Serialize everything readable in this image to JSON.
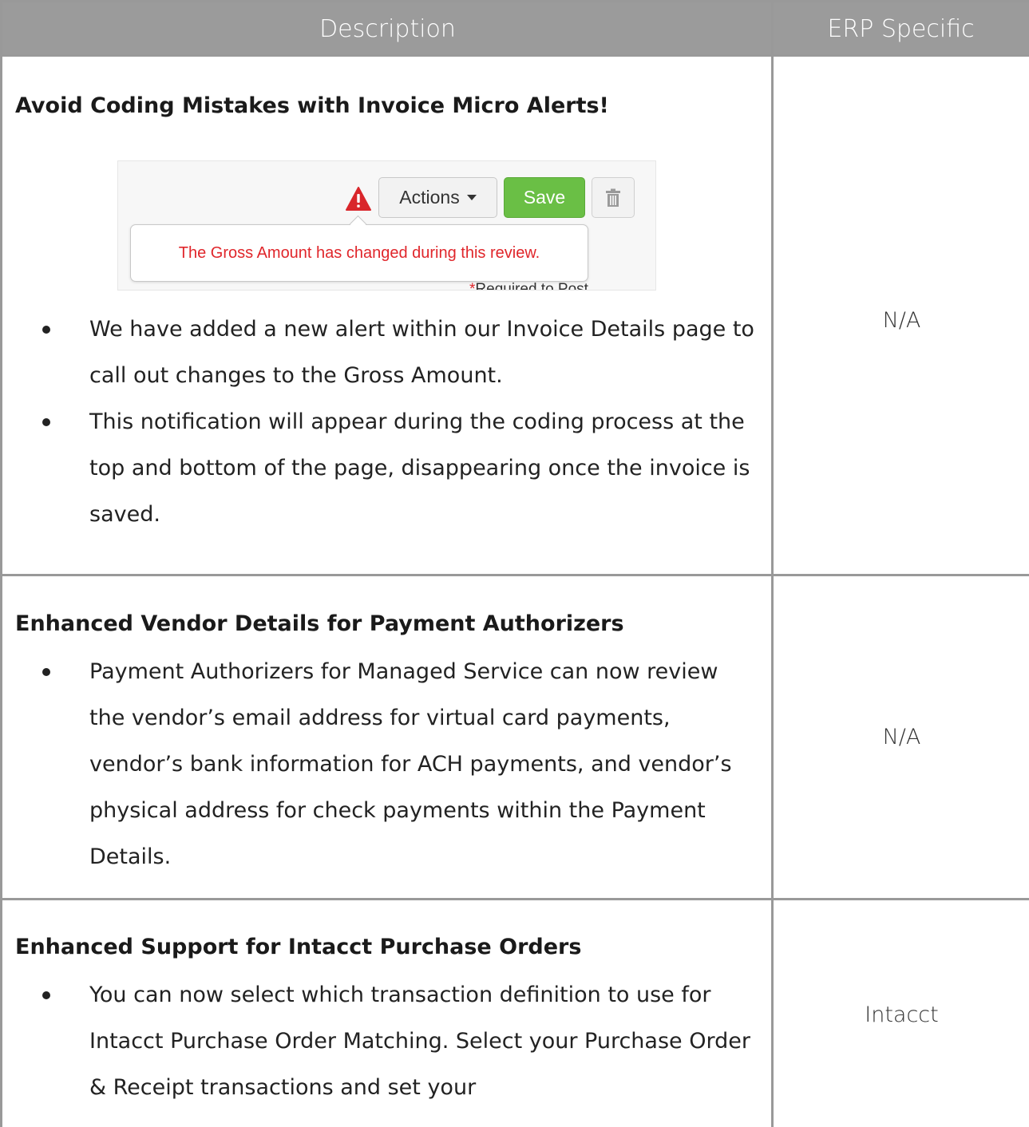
{
  "header": {
    "description": "Description",
    "erp_specific": "ERP Specific"
  },
  "rows": [
    {
      "title": "Avoid Coding Mistakes with Invoice Micro Alerts!",
      "screenshot": {
        "actions_label": "Actions",
        "save_label": "Save",
        "alert_text": "The Gross Amount has changed during this review.",
        "required_text": "Required to Post",
        "icons": [
          "warning-icon",
          "caret-down-icon",
          "trash-icon"
        ],
        "colors": {
          "save": "#6abf45",
          "alert": "#e0262b"
        }
      },
      "bullets": [
        "We have added a new alert within our Invoice Details page to call out changes to the Gross Amount.",
        "This notification will appear during the coding process at the top and bottom of the page, disappearing once the invoice is saved."
      ],
      "erp": "N/A"
    },
    {
      "title": "Enhanced Vendor Details for Payment Authorizers",
      "bullets": [
        "Payment Authorizers for Managed Service can now review the vendor’s email address for virtual card payments, vendor’s bank information for ACH payments, and vendor’s physical address for check payments within the Payment Details."
      ],
      "erp": "N/A"
    },
    {
      "title": "Enhanced Support for Intacct Purchase Orders",
      "bullets": [
        "You can now select which transaction definition to use for Intacct Purchase Order Matching. Select your Purchase Order & Receipt transactions and set your"
      ],
      "erp": "Intacct"
    }
  ]
}
